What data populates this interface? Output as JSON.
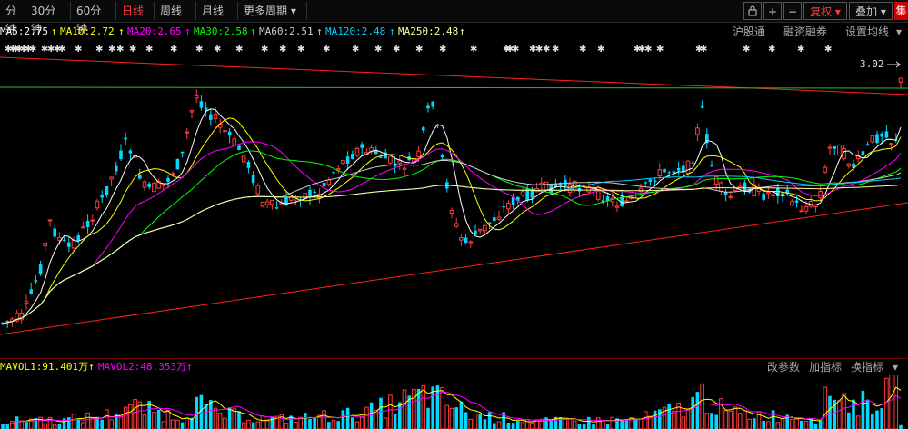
{
  "toolbar": {
    "period_tabs": [
      {
        "label": "分钟",
        "active": false
      },
      {
        "label": "30分钟",
        "active": false
      },
      {
        "label": "60分钟",
        "active": false
      },
      {
        "label": "日线",
        "active": true
      },
      {
        "label": "周线",
        "active": false
      },
      {
        "label": "月线",
        "active": false
      },
      {
        "label": "更多周期",
        "active": false
      }
    ],
    "more_arrow": "▾",
    "lock_icon": "lock-icon",
    "plus": "+",
    "minus": "−",
    "fuquan": "复权",
    "diejia": "叠加",
    "edge_label": "集",
    "dropdown_arrow": "▾"
  },
  "ma_legend": [
    {
      "label": "MA5:2.75",
      "color": "#ffffff"
    },
    {
      "label": "MA10:2.72",
      "color": "#ffff00"
    },
    {
      "label": "MA20:2.65",
      "color": "#ff00ff"
    },
    {
      "label": "MA30:2.58",
      "color": "#00ff00"
    },
    {
      "label": "MA60:2.51",
      "color": "#cccccc"
    },
    {
      "label": "MA120:2.48",
      "color": "#00cfff"
    },
    {
      "label": "MA250:2.48",
      "color": "#ffff99"
    }
  ],
  "ma_buttons": {
    "hgt": "沪股通",
    "margin": "融资融券",
    "settings": "设置均线"
  },
  "price_label": "3.02",
  "vol_legend": [
    {
      "label": "MAVOL1:91.401万",
      "color": "#ffff00",
      "arrow": "↑"
    },
    {
      "label": "MAVOL2:48.353万",
      "color": "#ff00ff",
      "arrow": "↑"
    }
  ],
  "vol_buttons": {
    "edit": "改参数",
    "add": "加指标",
    "switch": "换指标"
  },
  "colors": {
    "up": "#ff3b3b",
    "down": "#00d8ff",
    "background": "#000000",
    "trend": "#ff2020"
  }
}
